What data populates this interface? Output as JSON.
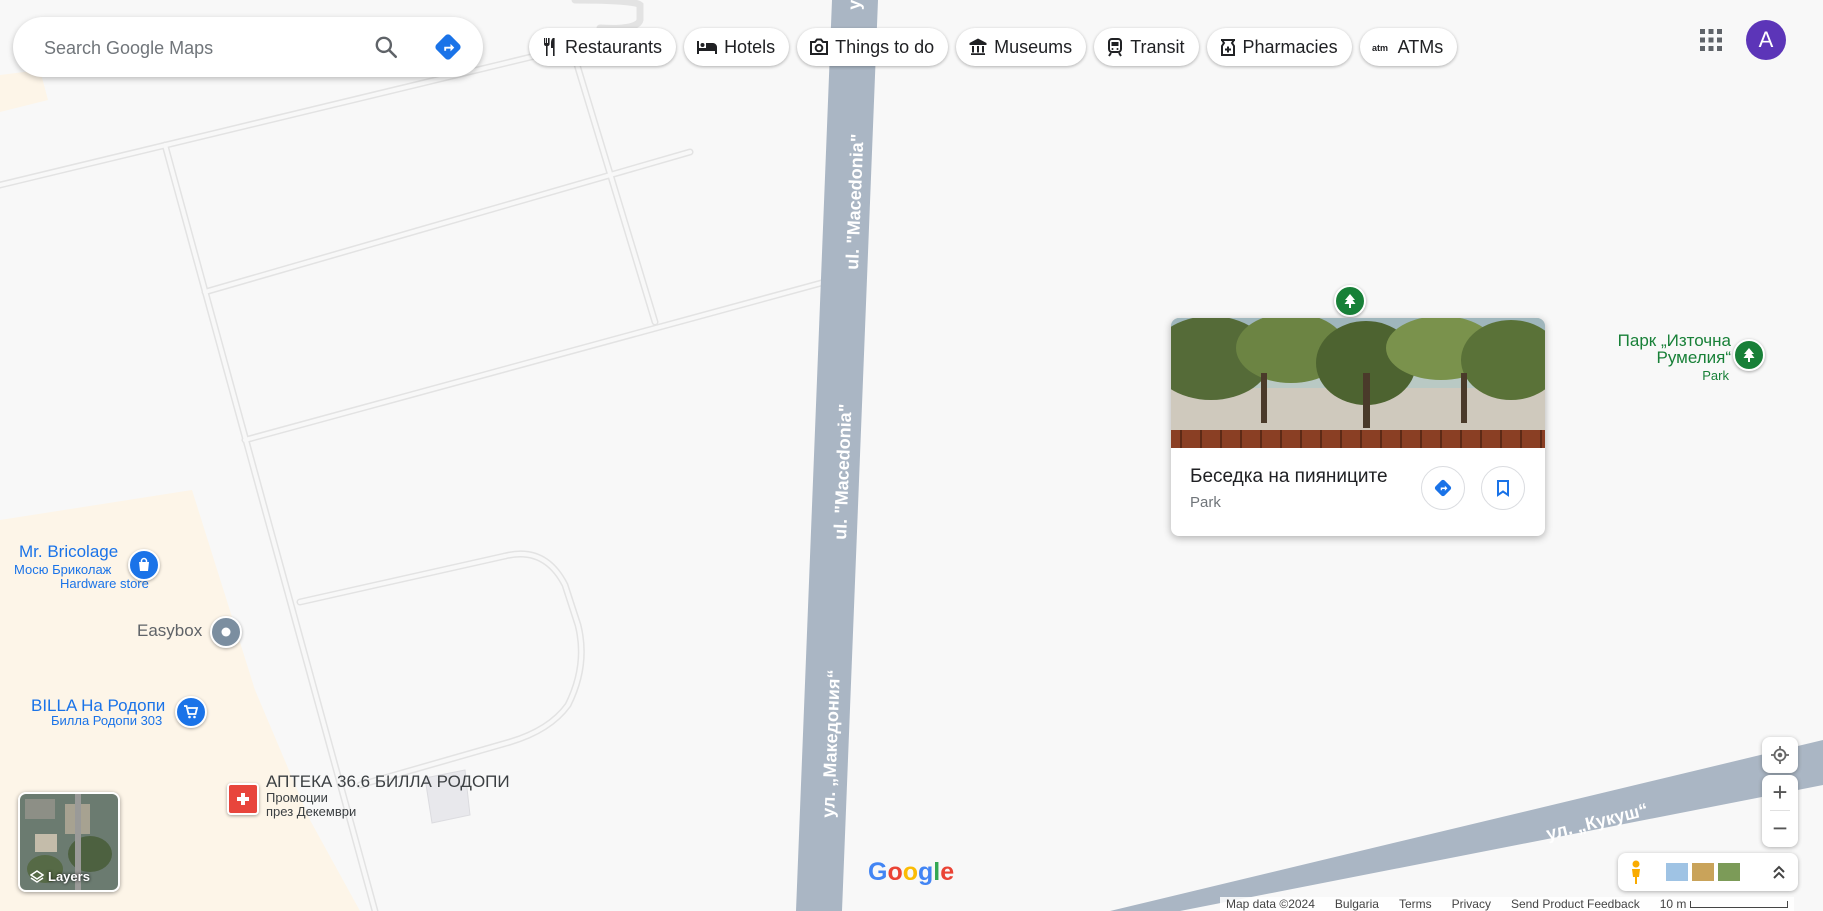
{
  "search": {
    "placeholder": "Search Google Maps"
  },
  "chips": [
    {
      "label": "Restaurants",
      "icon": "fork-knife-icon"
    },
    {
      "label": "Hotels",
      "icon": "bed-icon"
    },
    {
      "label": "Things to do",
      "icon": "camera-icon"
    },
    {
      "label": "Museums",
      "icon": "museum-icon"
    },
    {
      "label": "Transit",
      "icon": "train-icon"
    },
    {
      "label": "Pharmacies",
      "icon": "pharmacy-icon"
    },
    {
      "label": "ATMs",
      "icon": "atm-icon"
    }
  ],
  "account": {
    "initial": "A"
  },
  "roads": {
    "macedonia_latin_top": "ul. \"Macedonia\"",
    "macedonia_latin_mid": "ul. \"Macedonia\"",
    "macedonia_cyrillic": "ул. „Македония“",
    "kukush": "ул. „Кукуш“",
    "top_edge_fragment": "у"
  },
  "places": {
    "bricolage": {
      "name": "Mr. Bricolage",
      "alt_name": "Мосю Бриколаж",
      "category": "Hardware store"
    },
    "easybox": {
      "name": "Easybox"
    },
    "billa": {
      "name": "BILLA На Родопи",
      "subtitle": "Билла Родопи 303"
    },
    "pharmacy": {
      "name": "АПТЕКА 36.6 БИЛЛА РОДОПИ",
      "line1": "Промоции",
      "line2": "през Декември"
    },
    "park": {
      "name_line1": "Парк „Източна",
      "name_line2": "Румелия“",
      "category": "Park"
    }
  },
  "place_card": {
    "name": "Беседка на пияниците",
    "category": "Park"
  },
  "controls": {
    "layers_label": "Layers",
    "zoom_in": "+",
    "zoom_out": "−"
  },
  "footer": {
    "map_data": "Map data ©2024",
    "country": "Bulgaria",
    "terms": "Terms",
    "privacy": "Privacy",
    "feedback": "Send Product Feedback",
    "scale": "10 m"
  },
  "colors": {
    "road_major": "#aab6c4",
    "park_green": "#188038",
    "poi_blue": "#1a73e8",
    "pharmacy_red": "#e8453c",
    "accent": "#1a73e8",
    "avatar": "#5c35b8"
  }
}
